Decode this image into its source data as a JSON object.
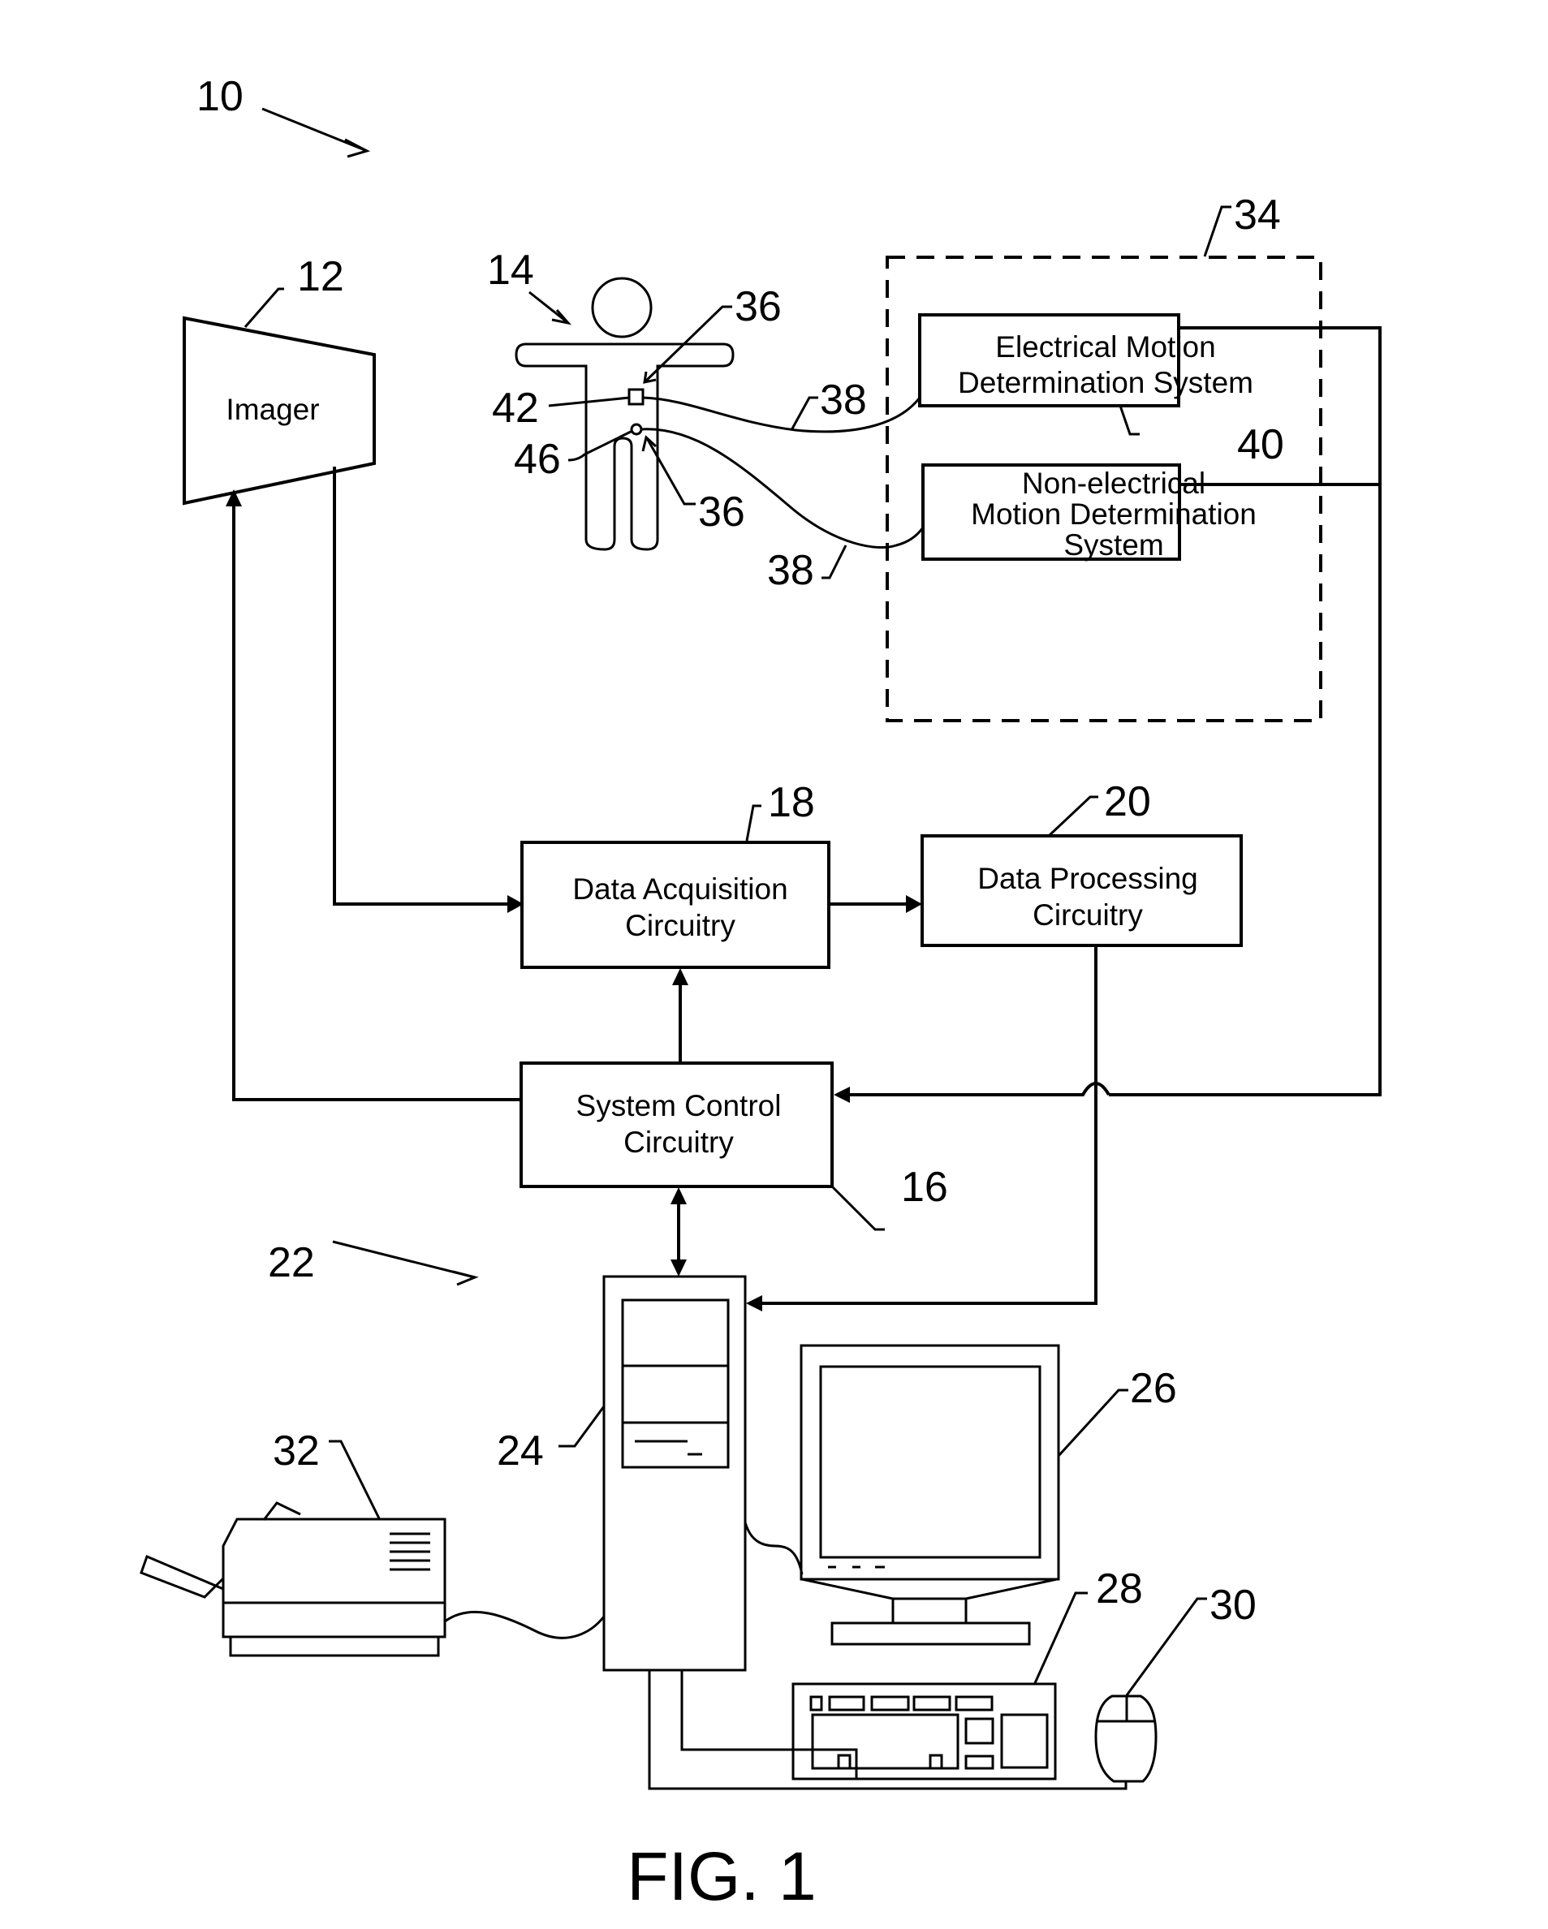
{
  "figure": {
    "caption": "FIG. 1",
    "system_ref": "10"
  },
  "blocks": {
    "imager": {
      "ref": "12",
      "label": "Imager"
    },
    "patient": {
      "ref": "14"
    },
    "system_control": {
      "ref": "16",
      "lines": [
        "System Control",
        "Circuitry"
      ]
    },
    "data_acquisition": {
      "ref": "18",
      "lines": [
        "Data Acquisition",
        "Circuitry"
      ]
    },
    "data_processing": {
      "ref": "20",
      "lines": [
        "Data Processing",
        "Circuitry"
      ]
    },
    "motion_group": {
      "ref": "34"
    },
    "electrical_motion": {
      "ref": "40",
      "lines": [
        "Electrical Motion",
        "Determination System"
      ]
    },
    "nonelectrical_motion": {
      "ref": "42",
      "lines": [
        "Non-electrical",
        "Motion Determination",
        "System"
      ]
    }
  },
  "sensors": {
    "sensor_ref_upper": "36",
    "sensor_ref_lower": "36",
    "electrode_ref": "42",
    "nonelectrode_ref": "46",
    "lead_ref_upper": "38",
    "lead_ref_lower": "38"
  },
  "workstation": {
    "ref": "22",
    "computer_ref": "24",
    "monitor_ref": "26",
    "keyboard_ref": "28",
    "mouse_ref": "30",
    "printer_ref": "32"
  }
}
